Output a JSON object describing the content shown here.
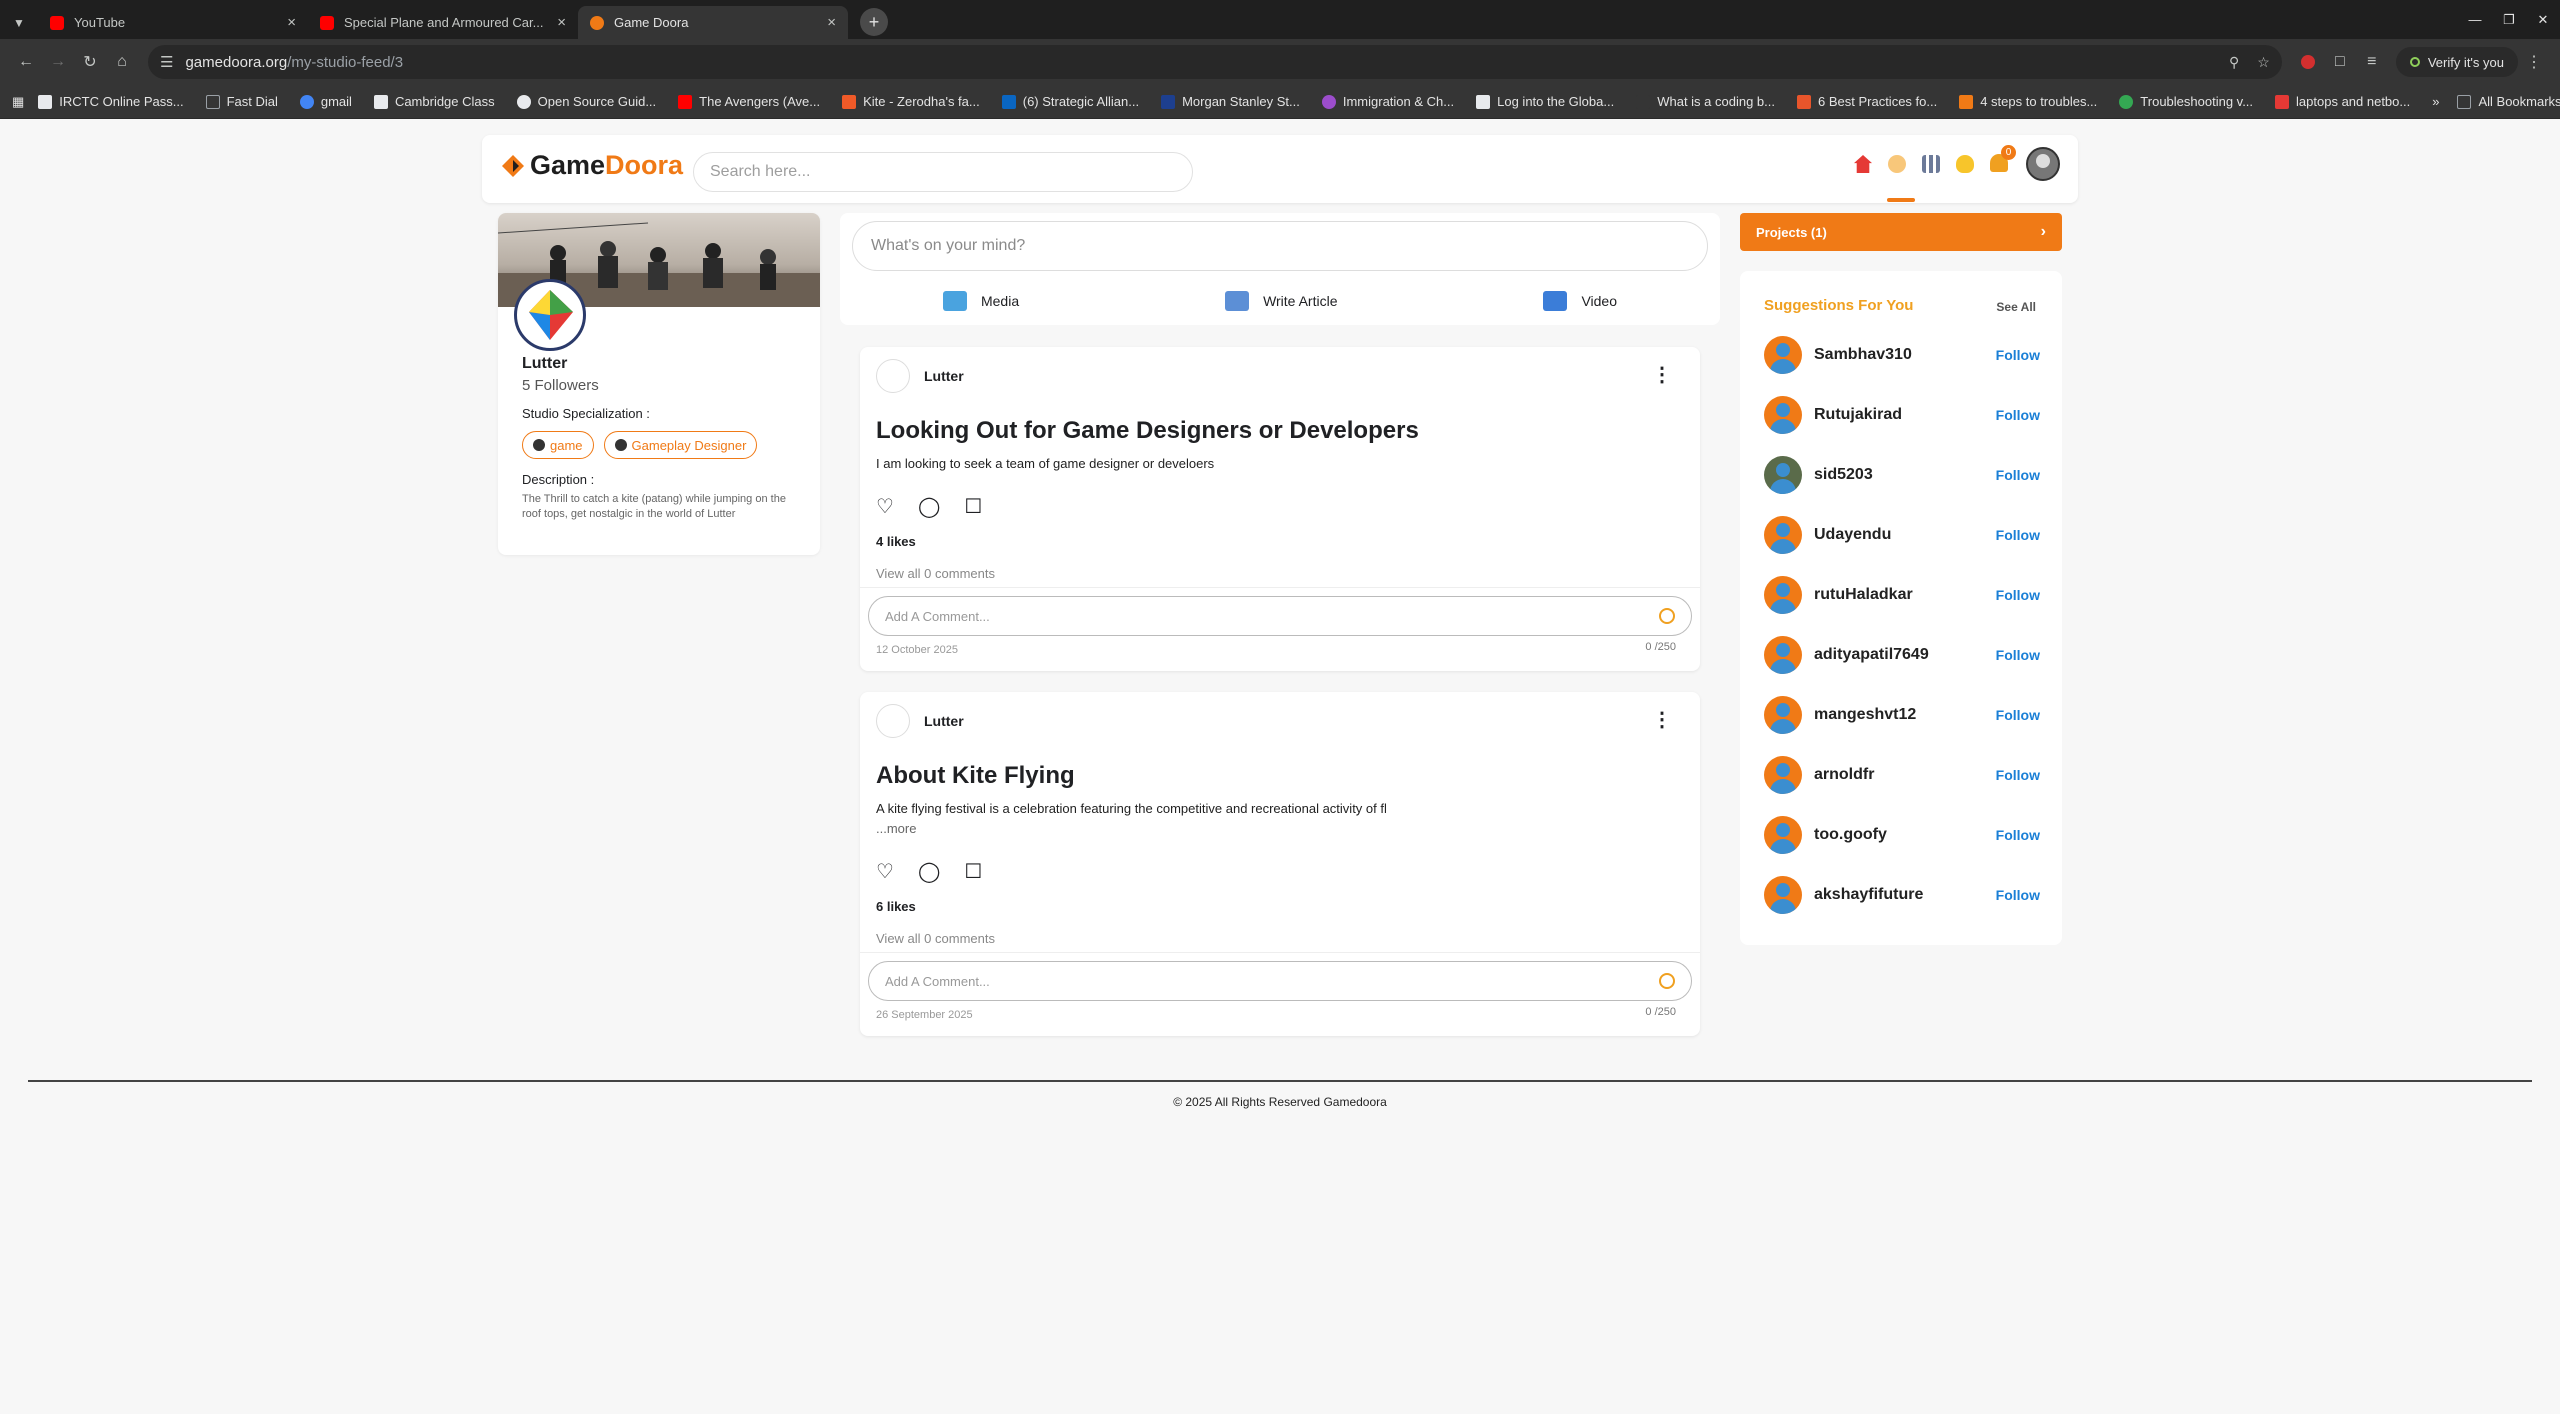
{
  "browser": {
    "tabs": [
      {
        "title": "YouTube",
        "icon": "youtube-icon",
        "color": "#ff0000"
      },
      {
        "title": "Special Plane and Armoured Car...",
        "icon": "youtube-icon",
        "color": "#ff0000"
      },
      {
        "title": "Game Doora",
        "icon": "gamedoora-icon",
        "color": "#f07a16",
        "active": true
      }
    ],
    "url_domain": "gamedoora.org",
    "url_path": "/my-studio-feed/3",
    "verify": "Verify it's you",
    "bookmarks": [
      {
        "label": "IRCTC Online Pass...",
        "color": "#e8eaed"
      },
      {
        "label": "Fast Dial",
        "color": "#9aa0a6"
      },
      {
        "label": "gmail",
        "color": "#4285f4"
      },
      {
        "label": "Cambridge Class",
        "color": "#e8eaed"
      },
      {
        "label": "Open Source Guid...",
        "color": "#e8eaed"
      },
      {
        "label": "The Avengers (Ave...",
        "color": "#ff0000"
      },
      {
        "label": "Kite - Zerodha's fa...",
        "color": "#f05a28"
      },
      {
        "label": "(6) Strategic Allian...",
        "color": "#0a66c2"
      },
      {
        "label": "Morgan Stanley St...",
        "color": "#1d3f8f"
      },
      {
        "label": "Immigration & Ch...",
        "color": "#9c4dcc"
      },
      {
        "label": "Log into the Globa...",
        "color": "#e8eaed"
      },
      {
        "label": "What is a coding b...",
        "color": "#353535"
      },
      {
        "label": "6 Best Practices fo...",
        "color": "#e8552b"
      },
      {
        "label": "4 steps to troubles...",
        "color": "#f07a16"
      },
      {
        "label": "Troubleshooting v...",
        "color": "#34a853"
      },
      {
        "label": "laptops and netbo...",
        "color": "#e53935"
      }
    ],
    "all_bookmarks": "All Bookmarks"
  },
  "header": {
    "logo_prefix": "Game",
    "logo_suffix": "Doora",
    "search_placeholder": "Search here...",
    "notification_count": "0"
  },
  "profile": {
    "name": "Lutter",
    "followers": "5 Followers",
    "specialization_label": "Studio Specialization :",
    "chips": [
      "game",
      "Gameplay Designer"
    ],
    "description_label": "Description :",
    "description": "The Thrill to catch a kite (patang) while jumping on the roof tops, get nostalgic in the world of Lutter"
  },
  "composer": {
    "placeholder": "What's on your mind?",
    "actions": [
      {
        "label": "Media",
        "icon": "image-icon",
        "color": "#4aa3df"
      },
      {
        "label": "Write Article",
        "icon": "article-icon",
        "color": "#5c8fd6"
      },
      {
        "label": "Video",
        "icon": "video-icon",
        "color": "#3b7dd8"
      }
    ]
  },
  "posts": [
    {
      "author": "Lutter",
      "title": "Looking Out for Game Designers or Developers",
      "body": "I am looking to seek a team of game designer or develoers",
      "more": "",
      "likes": "4 likes",
      "comments": "View all 0 comments",
      "comment_placeholder": "Add A Comment...",
      "date": "12 October 2025",
      "count": "0 /250"
    },
    {
      "author": "Lutter",
      "title": "About Kite Flying",
      "body": "A kite flying festival is a celebration featuring the competitive and recreational activity of fl",
      "more": "...more",
      "likes": "6 likes",
      "comments": "View all 0 comments",
      "comment_placeholder": "Add A Comment...",
      "date": "26 September 2025",
      "count": "0 /250"
    }
  ],
  "projects": {
    "label": "Projects (1)"
  },
  "suggestions": {
    "title": "Suggestions For You",
    "see_all": "See All",
    "follow_label": "Follow",
    "users": [
      "Sambhav310",
      "Rutujakirad",
      "sid5203",
      "Udayendu",
      "rutuHaladkar",
      "adityapatil7649",
      "mangeshvt12",
      "arnoldfr",
      "too.goofy",
      "akshayfifuture"
    ]
  },
  "footer": {
    "copyright": "© 2025 All Rights Reserved Gamedoora"
  },
  "colors": {
    "accent": "#f07a16",
    "link": "#1a7fd6"
  }
}
